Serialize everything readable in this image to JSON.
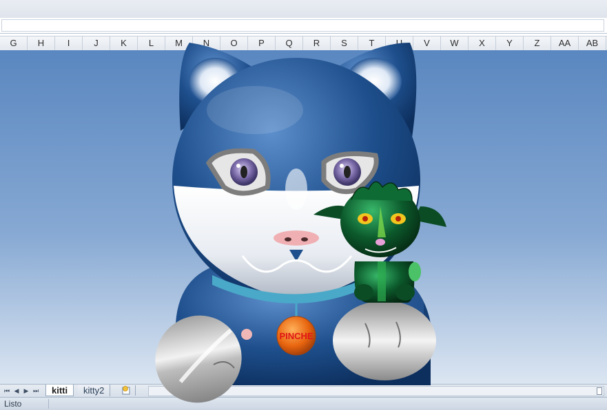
{
  "columns": [
    "G",
    "H",
    "I",
    "J",
    "K",
    "L",
    "M",
    "N",
    "O",
    "P",
    "Q",
    "R",
    "S",
    "T",
    "U",
    "V",
    "W",
    "X",
    "Y",
    "Z",
    "AA",
    "AB"
  ],
  "medallion": {
    "text": "PINCHE",
    "text_color": "#e01616",
    "fill": "#e8650f"
  },
  "sheet_nav": {
    "first": "⏮",
    "prev": "◀",
    "next": "▶",
    "last": "⏭"
  },
  "sheet_tabs": [
    {
      "label": "kitti",
      "active": true
    },
    {
      "label": "kitty2",
      "active": false
    }
  ],
  "new_sheet_icon": "insert-sheet-icon",
  "status": {
    "mode": "Listo"
  },
  "colors": {
    "sheet_background_top": "#5a87c0",
    "cat_blue": "#1f4f8a",
    "collar": "#4aa9c8",
    "dragon_green": "#0c5a2c"
  }
}
